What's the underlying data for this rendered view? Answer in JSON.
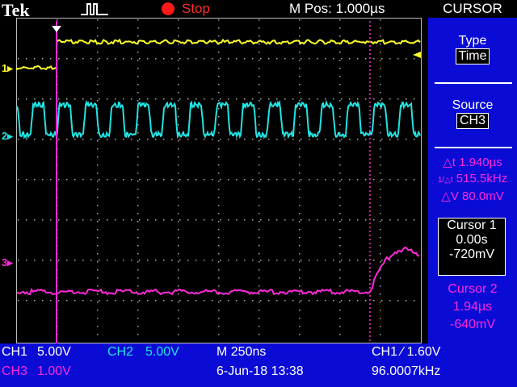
{
  "brand": "Tek",
  "acquisition": {
    "state": "Stop"
  },
  "main_position": "M Pos: 1.000µs",
  "menu": {
    "title": "CURSOR"
  },
  "sidebar": {
    "type_label": "Type",
    "type_value": "Time",
    "source_label": "Source",
    "source_value": "CH3",
    "delta_t": "△t 1.940µs",
    "inv_delta_t": "515.5kHz",
    "inv_delta_t_prefix": "1/△t",
    "delta_v": "△V 80.0mV",
    "cursor1": {
      "label": "Cursor 1",
      "time": "0.00s",
      "volt": "-720mV"
    },
    "cursor2": {
      "label": "Cursor 2",
      "time": "1.94µs",
      "volt": "-640mV"
    }
  },
  "channels": {
    "ch1": {
      "label": "CH1",
      "scale": "5.00V",
      "marker": "1"
    },
    "ch2": {
      "label": "CH2",
      "scale": "5.00V",
      "marker": "2"
    },
    "ch3": {
      "label": "CH3",
      "scale": "1.00V",
      "marker": "3"
    }
  },
  "timebase": "M 250ns",
  "trigger": {
    "source": "CH1",
    "slope": "∕",
    "level": "1.60V"
  },
  "date": "6-Jun-18 13:38",
  "frequency": "96.0007kHz",
  "colors": {
    "ch1": "#ffff2a",
    "ch2": "#21e3e3",
    "ch3": "#ff2ad8",
    "panel": "#0b0bd6",
    "stop": "#ff1a1a"
  }
}
